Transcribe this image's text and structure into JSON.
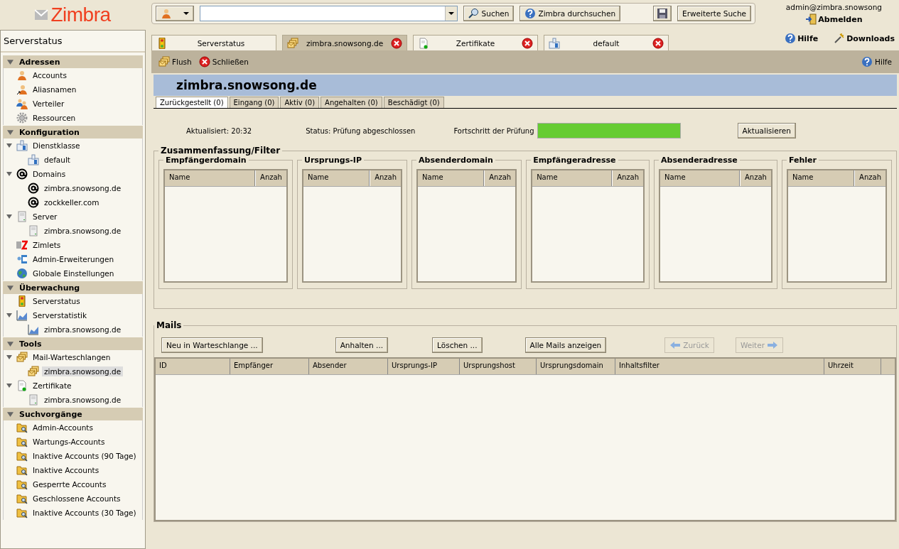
{
  "logo": "Zimbra",
  "search": {
    "search_button": "Suchen",
    "zimbra_button": "Zimbra durchsuchen",
    "advanced_button": "Erweiterte Suche"
  },
  "user": {
    "email": "admin@zimbra.snowsong",
    "logout": "Abmelden",
    "help": "Hilfe",
    "downloads": "Downloads"
  },
  "sidebar": {
    "title": "Serverstatus",
    "sections": [
      {
        "title": "Adressen",
        "expanded": true,
        "items": [
          {
            "label": "Accounts",
            "kind": "person",
            "selected": false
          },
          {
            "label": "Aliasnamen",
            "kind": "alias",
            "selected": false
          },
          {
            "label": "Verteiler",
            "kind": "group",
            "selected": false
          },
          {
            "label": "Ressourcen",
            "kind": "gear",
            "selected": false
          }
        ]
      },
      {
        "title": "Konfiguration",
        "expanded": true,
        "items": [
          {
            "label": "Dienstklasse",
            "kind": "cos",
            "selected": false,
            "expanded": true,
            "children": [
              {
                "label": "default",
                "kind": "cos",
                "selected": false
              }
            ]
          },
          {
            "label": "Domains",
            "kind": "at",
            "selected": false,
            "expanded": true,
            "children": [
              {
                "label": "zimbra.snowsong.de",
                "kind": "at",
                "selected": false
              },
              {
                "label": "zockkeller.com",
                "kind": "at",
                "selected": false
              }
            ]
          },
          {
            "label": "Server",
            "kind": "server",
            "selected": false,
            "expanded": true,
            "children": [
              {
                "label": "zimbra.snowsong.de",
                "kind": "server",
                "selected": false
              }
            ]
          },
          {
            "label": "Zimlets",
            "kind": "zimlet",
            "selected": false
          },
          {
            "label": "Admin-Erweiterungen",
            "kind": "ext",
            "selected": false
          },
          {
            "label": "Globale Einstellungen",
            "kind": "globe",
            "selected": false
          }
        ]
      },
      {
        "title": "Überwachung",
        "expanded": true,
        "items": [
          {
            "label": "Serverstatus",
            "kind": "traffic",
            "selected": false
          },
          {
            "label": "Serverstatistik",
            "kind": "chart",
            "selected": false,
            "expanded": true,
            "children": [
              {
                "label": "zimbra.snowsong.de",
                "kind": "chart",
                "selected": false
              }
            ]
          }
        ]
      },
      {
        "title": "Tools",
        "expanded": true,
        "items": [
          {
            "label": "Mail-Warteschlangen",
            "kind": "queue",
            "selected": false,
            "expanded": true,
            "children": [
              {
                "label": "zimbra.snowsong.de",
                "kind": "queue",
                "selected": true
              }
            ]
          },
          {
            "label": "Zertifikate",
            "kind": "cert",
            "selected": false,
            "expanded": true,
            "children": [
              {
                "label": "zimbra.snowsong.de",
                "kind": "server",
                "selected": false
              }
            ]
          }
        ]
      },
      {
        "title": "Suchvorgänge",
        "expanded": true,
        "items": [
          {
            "label": "Admin-Accounts",
            "kind": "folder",
            "selected": false
          },
          {
            "label": "Wartungs-Accounts",
            "kind": "folder",
            "selected": false
          },
          {
            "label": "Inaktive Accounts (90 Tage)",
            "kind": "folder",
            "selected": false
          },
          {
            "label": "Inaktive Accounts",
            "kind": "folder",
            "selected": false
          },
          {
            "label": "Gesperrte Accounts",
            "kind": "folder",
            "selected": false
          },
          {
            "label": "Geschlossene Accounts",
            "kind": "folder",
            "selected": false
          },
          {
            "label": "Inaktive Accounts (30 Tage)",
            "kind": "folder",
            "selected": false
          }
        ]
      }
    ]
  },
  "tabs": [
    {
      "label": "Serverstatus",
      "kind": "traffic",
      "selected": false,
      "closable": false
    },
    {
      "label": "zimbra.snowsong.de",
      "kind": "queue",
      "selected": true,
      "closable": true
    },
    {
      "label": "Zertifikate",
      "kind": "cert",
      "selected": false,
      "closable": true
    },
    {
      "label": "default",
      "kind": "cos",
      "selected": false,
      "closable": true
    }
  ],
  "toolbar": {
    "flush": "Flush",
    "close": "Schließen",
    "help": "Hilfe"
  },
  "page_title": "zimbra.snowsong.de",
  "subtabs": [
    {
      "label": "Zurückgestellt (0)",
      "selected": true
    },
    {
      "label": "Eingang (0)",
      "selected": false
    },
    {
      "label": "Aktiv (0)",
      "selected": false
    },
    {
      "label": "Angehalten (0)",
      "selected": false
    },
    {
      "label": "Beschädigt (0)",
      "selected": false
    }
  ],
  "status": {
    "updated_label": "Aktualisiert:",
    "updated_value": "20:32",
    "status_label": "Status:",
    "status_value": "Prüfung abgeschlossen",
    "progress_label": "Fortschritt der Prüfung",
    "level": 1,
    "refresh_button": "Aktualisieren"
  },
  "summary": {
    "title": "Zusammenfassung/Filter",
    "panels": [
      {
        "title": "Empfängerdomain",
        "columns": [
          "Name",
          "Anzah"
        ]
      },
      {
        "title": "Ursprungs-IP",
        "columns": [
          "Name",
          "Anzah"
        ]
      },
      {
        "title": "Absenderdomain",
        "columns": [
          "Name",
          "Anzah"
        ]
      },
      {
        "title": "Empfängeradresse",
        "columns": [
          "Name",
          "Anzah"
        ]
      },
      {
        "title": "Absenderadresse",
        "columns": [
          "Name",
          "Anzah"
        ]
      },
      {
        "title": "Fehler",
        "columns": [
          "Name",
          "Anzah"
        ]
      }
    ]
  },
  "mails": {
    "title": "Mails",
    "buttons": [
      {
        "label": "Neu in Warteschlange ...",
        "disabled": false
      },
      {
        "label": "Anhalten ...",
        "disabled": false
      },
      {
        "label": "Löschen ...",
        "disabled": false
      },
      {
        "label": "Alle Mails anzeigen",
        "disabled": false
      }
    ],
    "prev": {
      "label": "Zurück",
      "disabled": true
    },
    "next": {
      "label": "Weiter",
      "disabled": true
    },
    "columns": [
      "ID",
      "Empfänger",
      "Absender",
      "Ursprungs-IP",
      "Ursprungshost",
      "Ursprungsdomain",
      "Inhaltsfilter",
      "Uhrzeit"
    ]
  }
}
